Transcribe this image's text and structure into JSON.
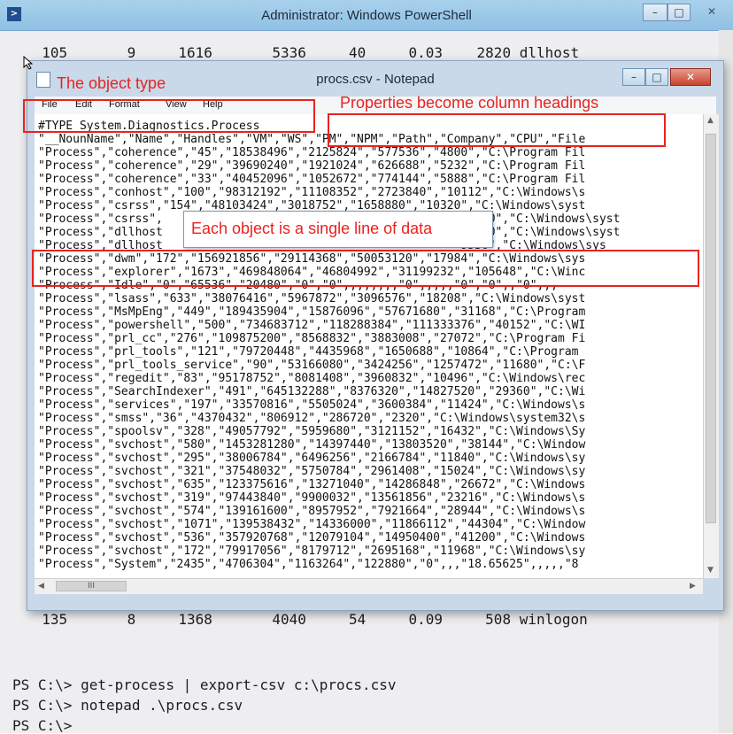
{
  "powershell": {
    "title": "Administrator: Windows PowerShell",
    "icon": "powershell-icon",
    "row_top": "  105       9     1616       5336     40     0.03    2820 dllhost",
    "row_bottom": "  135       8     1368       4040     54     0.09     508 winlogon",
    "prompts": [
      "PS C:\\> get-process | export-csv c:\\procs.csv",
      "PS C:\\> notepad .\\procs.csv",
      "PS C:\\>"
    ]
  },
  "notepad": {
    "title": "procs.csv - Notepad",
    "menu": [
      "File",
      "Edit",
      "Format",
      "View",
      "Help"
    ],
    "lines": [
      "#TYPE System.Diagnostics.Process",
      "\"__NounName\",\"Name\",\"Handles\",\"VM\",\"WS\",\"PM\",\"NPM\",\"Path\",\"Company\",\"CPU\",\"File",
      "\"Process\",\"coherence\",\"45\",\"18538496\",\"2125824\",\"577536\",\"4800\",\"C:\\Program Fil",
      "\"Process\",\"coherence\",\"29\",\"39690240\",\"1921024\",\"626688\",\"5232\",\"C:\\Program Fil",
      "\"Process\",\"coherence\",\"33\",\"40452096\",\"1052672\",\"774144\",\"5888\",\"C:\\Program Fil",
      "\"Process\",\"conhost\",\"100\",\"98312192\",\"11108352\",\"2723840\",\"10112\",\"C:\\Windows\\s",
      "\"Process\",\"csrss\",\"154\",\"48103424\",\"3018752\",\"1658880\",\"10320\",\"C:\\Windows\\syst",
      "\"Process\",\"csrss\",                                          \"13440\",\"C:\\Windows\\syst",
      "\"Process\",\"dllhost                                          ,\"6720\",\"C:\\Windows\\syst",
      "\"Process\",\"dllhost                                          \"9536\",\"C:\\Windows\\sys",
      "\"Process\",\"dwm\",\"172\",\"156921856\",\"29114368\",\"50053120\",\"17984\",\"C:\\Windows\\sys",
      "\"Process\",\"explorer\",\"1673\",\"469848064\",\"46804992\",\"31199232\",\"105648\",\"C:\\Winc",
      "\"Process\",\"Idle\",\"0\",\"65536\",\"20480\",\"0\",\"0\",,,,,,,,\"0\",,,,,\"0\",\"0\",,\"0\",,,",
      "\"Process\",\"lsass\",\"633\",\"38076416\",\"5967872\",\"3096576\",\"18208\",\"C:\\Windows\\syst",
      "\"Process\",\"MsMpEng\",\"449\",\"189435904\",\"15876096\",\"57671680\",\"31168\",\"C:\\Program",
      "\"Process\",\"powershell\",\"500\",\"734683712\",\"118288384\",\"111333376\",\"40152\",\"C:\\WI",
      "\"Process\",\"prl_cc\",\"276\",\"109875200\",\"8568832\",\"3883008\",\"27072\",\"C:\\Program Fi",
      "\"Process\",\"prl_tools\",\"121\",\"79720448\",\"4435968\",\"1650688\",\"10864\",\"C:\\Program",
      "\"Process\",\"prl_tools_service\",\"90\",\"53166080\",\"3424256\",\"1257472\",\"11680\",\"C:\\F",
      "\"Process\",\"regedit\",\"83\",\"95178752\",\"8081408\",\"3960832\",\"10496\",\"C:\\Windows\\rec",
      "\"Process\",\"SearchIndexer\",\"491\",\"645132288\",\"8376320\",\"14827520\",\"29360\",\"C:\\Wi",
      "\"Process\",\"services\",\"197\",\"33570816\",\"5505024\",\"3600384\",\"11424\",\"C:\\Windows\\s",
      "\"Process\",\"smss\",\"36\",\"4370432\",\"806912\",\"286720\",\"2320\",\"C:\\Windows\\system32\\s",
      "\"Process\",\"spoolsv\",\"328\",\"49057792\",\"5959680\",\"3121152\",\"16432\",\"C:\\Windows\\Sy",
      "\"Process\",\"svchost\",\"580\",\"1453281280\",\"14397440\",\"13803520\",\"38144\",\"C:\\Window",
      "\"Process\",\"svchost\",\"295\",\"38006784\",\"6496256\",\"2166784\",\"11840\",\"C:\\Windows\\sy",
      "\"Process\",\"svchost\",\"321\",\"37548032\",\"5750784\",\"2961408\",\"15024\",\"C:\\Windows\\sy",
      "\"Process\",\"svchost\",\"635\",\"123375616\",\"13271040\",\"14286848\",\"26672\",\"C:\\Windows",
      "\"Process\",\"svchost\",\"319\",\"97443840\",\"9900032\",\"13561856\",\"23216\",\"C:\\Windows\\s",
      "\"Process\",\"svchost\",\"574\",\"139161600\",\"8957952\",\"7921664\",\"28944\",\"C:\\Windows\\s",
      "\"Process\",\"svchost\",\"1071\",\"139538432\",\"14336000\",\"11866112\",\"44304\",\"C:\\Window",
      "\"Process\",\"svchost\",\"536\",\"357920768\",\"12079104\",\"14950400\",\"41200\",\"C:\\Windows",
      "\"Process\",\"svchost\",\"172\",\"79917056\",\"8179712\",\"2695168\",\"11968\",\"C:\\Windows\\sy",
      "\"Process\",\"System\",\"2435\",\"4706304\",\"1163264\",\"122880\",\"0\",,,\"18.65625\",,,,,\"8"
    ],
    "hscroll_thumb": "III"
  },
  "annotations": {
    "object_type": "The object type",
    "properties": "Properties become column headings",
    "each_object": "Each object is a single line of data"
  },
  "colors": {
    "annotation": "#e8231f",
    "titlebar": "#a9d1ec"
  }
}
